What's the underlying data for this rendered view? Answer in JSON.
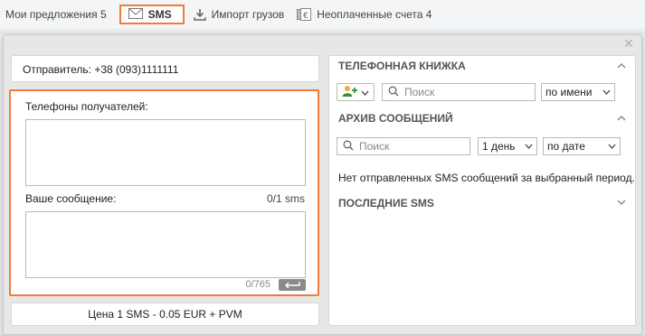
{
  "topbar": {
    "offers_label": "Мои предложения 5",
    "sms_label": "SMS",
    "import_label": "Импорт грузов",
    "unpaid_label": "Неоплаченные счета 4"
  },
  "sender": {
    "label": "Отправитель: +38 (093)1111111"
  },
  "compose": {
    "recipients_label": "Телефоны получателей:",
    "recipients_value": "",
    "message_label": "Ваше сообщение:",
    "sms_count": "0/1 sms",
    "message_value": "",
    "char_count": "0/765"
  },
  "price": {
    "label": "Цена 1 SMS - 0.05 EUR + PVM"
  },
  "phonebook": {
    "title": "ТЕЛЕФОННАЯ КНИЖКА",
    "search_placeholder": "Поиск",
    "sort_value": "по имени"
  },
  "archive": {
    "title": "АРХИВ СООБЩЕНИЙ",
    "search_placeholder": "Поиск",
    "period_value": "1 день",
    "sort_value": "по дате",
    "empty_message": "Нет отправленных SMS сообщений за выбранный период."
  },
  "recent": {
    "title": "ПОСЛЕДНИЕ SMS"
  },
  "colors": {
    "accent": "#f07b3a"
  }
}
